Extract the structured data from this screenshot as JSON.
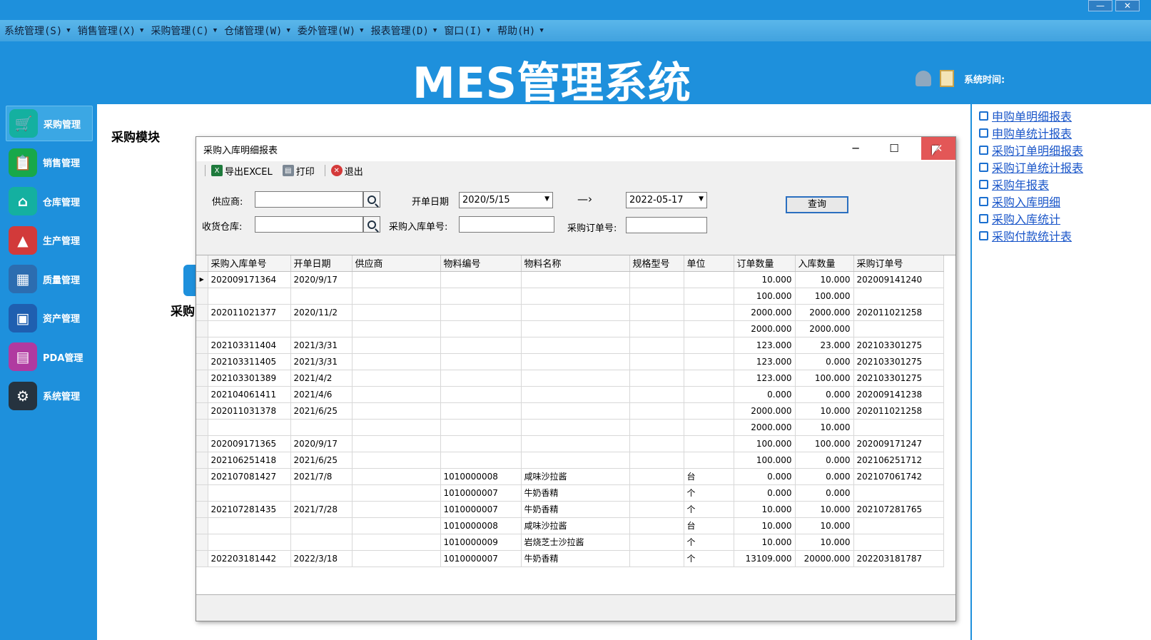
{
  "window_controls": {
    "minimize": "—",
    "close": "✕"
  },
  "menubar": {
    "items": [
      {
        "label": "系统管理(S)"
      },
      {
        "label": "销售管理(X)"
      },
      {
        "label": "采购管理(C)"
      },
      {
        "label": "仓储管理(W)"
      },
      {
        "label": "委外管理(W)"
      },
      {
        "label": "报表管理(D)"
      },
      {
        "label": "窗口(I)"
      },
      {
        "label": "帮助(H)"
      }
    ]
  },
  "header": {
    "title": "MES管理系统",
    "system_time_label": "系统时间:"
  },
  "sidebar": {
    "items": [
      {
        "label": "采购管理",
        "icon": "cart-icon",
        "color": "#14b0a0",
        "glyph": "🛒"
      },
      {
        "label": "销售管理",
        "icon": "clipboard-icon",
        "color": "#18a84a",
        "glyph": "📋"
      },
      {
        "label": "仓库管理",
        "icon": "home-icon",
        "color": "#14b0a0",
        "glyph": "⌂"
      },
      {
        "label": "生产管理",
        "icon": "factory-icon",
        "color": "#d23a3a",
        "glyph": "▲"
      },
      {
        "label": "质量管理",
        "icon": "shop-icon",
        "color": "#2c6db0",
        "glyph": "▦"
      },
      {
        "label": "资产管理",
        "icon": "monitor-icon",
        "color": "#1f5fb0",
        "glyph": "▣"
      },
      {
        "label": "PDA管理",
        "icon": "calculator-icon",
        "color": "#b03aa0",
        "glyph": "▤"
      },
      {
        "label": "系统管理",
        "icon": "gear-icon",
        "color": "#26333f",
        "glyph": "⚙"
      }
    ]
  },
  "content": {
    "module_title": "采购模块",
    "behind_label": "采购"
  },
  "report_links": [
    "申购单明细报表",
    "申购单统计报表",
    "采购订单明细报表",
    "采购订单统计报表",
    "采购年报表",
    "采购入库明细",
    "采购入库统计",
    "采购付款统计表"
  ],
  "dialog": {
    "title": "采购入库明细报表",
    "toolbar": {
      "export_label": "导出EXCEL",
      "print_label": "打印",
      "exit_label": "退出"
    },
    "filters": {
      "supplier_label": "供应商:",
      "supplier_value": "",
      "warehouse_label": "收货仓库:",
      "warehouse_value": "",
      "open_date_label": "开单日期",
      "date_from": "2020/5/15",
      "arrow": "—›",
      "date_to": "2022-05-17",
      "receipt_no_label": "采购入库单号:",
      "receipt_no_value": "",
      "order_no_label": "采购订单号:",
      "order_no_value": "",
      "query_label": "查询"
    },
    "columns": [
      "采购入库单号",
      "开单日期",
      "供应商",
      "物料编号",
      "物料名称",
      "规格型号",
      "单位",
      "订单数量",
      "入库数量",
      "采购订单号"
    ],
    "rows": [
      [
        "202009171364",
        "2020/9/17",
        "",
        "",
        "",
        "",
        "",
        "10.000",
        "10.000",
        "202009141240"
      ],
      [
        "",
        "",
        "",
        "",
        "",
        "",
        "",
        "100.000",
        "100.000",
        ""
      ],
      [
        "202011021377",
        "2020/11/2",
        "",
        "",
        "",
        "",
        "",
        "2000.000",
        "2000.000",
        "202011021258"
      ],
      [
        "",
        "",
        "",
        "",
        "",
        "",
        "",
        "2000.000",
        "2000.000",
        ""
      ],
      [
        "202103311404",
        "2021/3/31",
        "",
        "",
        "",
        "",
        "",
        "123.000",
        "23.000",
        "202103301275"
      ],
      [
        "202103311405",
        "2021/3/31",
        "",
        "",
        "",
        "",
        "",
        "123.000",
        "0.000",
        "202103301275"
      ],
      [
        "202103301389",
        "2021/4/2",
        "",
        "",
        "",
        "",
        "",
        "123.000",
        "100.000",
        "202103301275"
      ],
      [
        "202104061411",
        "2021/4/6",
        "",
        "",
        "",
        "",
        "",
        "0.000",
        "0.000",
        "202009141238"
      ],
      [
        "202011031378",
        "2021/6/25",
        "",
        "",
        "",
        "",
        "",
        "2000.000",
        "10.000",
        "202011021258"
      ],
      [
        "",
        "",
        "",
        "",
        "",
        "",
        "",
        "2000.000",
        "10.000",
        ""
      ],
      [
        "202009171365",
        "2020/9/17",
        "",
        "",
        "",
        "",
        "",
        "100.000",
        "100.000",
        "202009171247"
      ],
      [
        "202106251418",
        "2021/6/25",
        "",
        "",
        "",
        "",
        "",
        "100.000",
        "0.000",
        "202106251712"
      ],
      [
        "202107081427",
        "2021/7/8",
        "",
        "1010000008",
        "咸味沙拉酱",
        "",
        "台",
        "0.000",
        "0.000",
        "202107061742"
      ],
      [
        "",
        "",
        "",
        "1010000007",
        "牛奶香精",
        "",
        "个",
        "0.000",
        "0.000",
        ""
      ],
      [
        "202107281435",
        "2021/7/28",
        "",
        "1010000007",
        "牛奶香精",
        "",
        "个",
        "10.000",
        "10.000",
        "202107281765"
      ],
      [
        "",
        "",
        "",
        "1010000008",
        "咸味沙拉酱",
        "",
        "台",
        "10.000",
        "10.000",
        ""
      ],
      [
        "",
        "",
        "",
        "1010000009",
        "岩烧芝士沙拉酱",
        "",
        "个",
        "10.000",
        "10.000",
        ""
      ],
      [
        "202203181442",
        "2022/3/18",
        "",
        "1010000007",
        "牛奶香精",
        "",
        "个",
        "13109.000",
        "20000.000",
        "202203181787"
      ]
    ]
  }
}
